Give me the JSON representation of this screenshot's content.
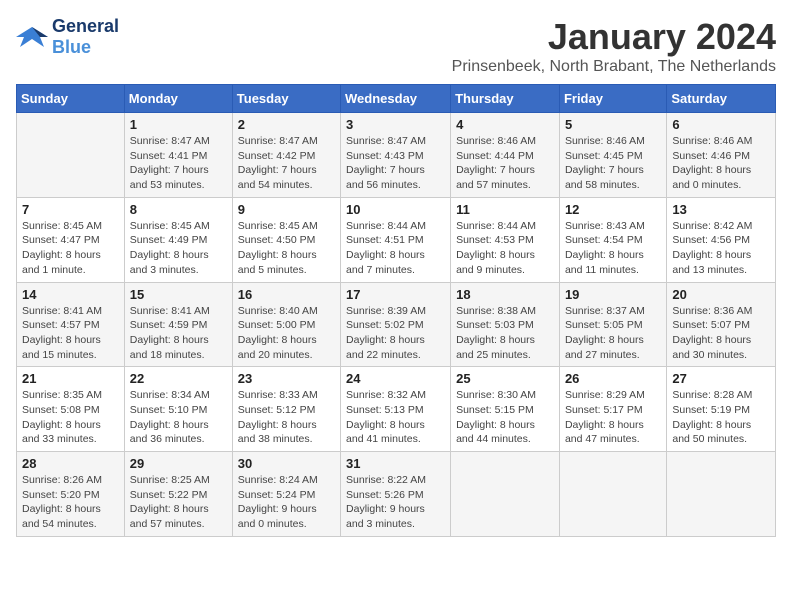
{
  "logo": {
    "line1": "General",
    "line2": "Blue"
  },
  "title": "January 2024",
  "subtitle": "Prinsenbeek, North Brabant, The Netherlands",
  "weekdays": [
    "Sunday",
    "Monday",
    "Tuesday",
    "Wednesday",
    "Thursday",
    "Friday",
    "Saturday"
  ],
  "weeks": [
    [
      {
        "day": "",
        "detail": ""
      },
      {
        "day": "1",
        "detail": "Sunrise: 8:47 AM\nSunset: 4:41 PM\nDaylight: 7 hours\nand 53 minutes."
      },
      {
        "day": "2",
        "detail": "Sunrise: 8:47 AM\nSunset: 4:42 PM\nDaylight: 7 hours\nand 54 minutes."
      },
      {
        "day": "3",
        "detail": "Sunrise: 8:47 AM\nSunset: 4:43 PM\nDaylight: 7 hours\nand 56 minutes."
      },
      {
        "day": "4",
        "detail": "Sunrise: 8:46 AM\nSunset: 4:44 PM\nDaylight: 7 hours\nand 57 minutes."
      },
      {
        "day": "5",
        "detail": "Sunrise: 8:46 AM\nSunset: 4:45 PM\nDaylight: 7 hours\nand 58 minutes."
      },
      {
        "day": "6",
        "detail": "Sunrise: 8:46 AM\nSunset: 4:46 PM\nDaylight: 8 hours\nand 0 minutes."
      }
    ],
    [
      {
        "day": "7",
        "detail": "Sunrise: 8:45 AM\nSunset: 4:47 PM\nDaylight: 8 hours\nand 1 minute."
      },
      {
        "day": "8",
        "detail": "Sunrise: 8:45 AM\nSunset: 4:49 PM\nDaylight: 8 hours\nand 3 minutes."
      },
      {
        "day": "9",
        "detail": "Sunrise: 8:45 AM\nSunset: 4:50 PM\nDaylight: 8 hours\nand 5 minutes."
      },
      {
        "day": "10",
        "detail": "Sunrise: 8:44 AM\nSunset: 4:51 PM\nDaylight: 8 hours\nand 7 minutes."
      },
      {
        "day": "11",
        "detail": "Sunrise: 8:44 AM\nSunset: 4:53 PM\nDaylight: 8 hours\nand 9 minutes."
      },
      {
        "day": "12",
        "detail": "Sunrise: 8:43 AM\nSunset: 4:54 PM\nDaylight: 8 hours\nand 11 minutes."
      },
      {
        "day": "13",
        "detail": "Sunrise: 8:42 AM\nSunset: 4:56 PM\nDaylight: 8 hours\nand 13 minutes."
      }
    ],
    [
      {
        "day": "14",
        "detail": "Sunrise: 8:41 AM\nSunset: 4:57 PM\nDaylight: 8 hours\nand 15 minutes."
      },
      {
        "day": "15",
        "detail": "Sunrise: 8:41 AM\nSunset: 4:59 PM\nDaylight: 8 hours\nand 18 minutes."
      },
      {
        "day": "16",
        "detail": "Sunrise: 8:40 AM\nSunset: 5:00 PM\nDaylight: 8 hours\nand 20 minutes."
      },
      {
        "day": "17",
        "detail": "Sunrise: 8:39 AM\nSunset: 5:02 PM\nDaylight: 8 hours\nand 22 minutes."
      },
      {
        "day": "18",
        "detail": "Sunrise: 8:38 AM\nSunset: 5:03 PM\nDaylight: 8 hours\nand 25 minutes."
      },
      {
        "day": "19",
        "detail": "Sunrise: 8:37 AM\nSunset: 5:05 PM\nDaylight: 8 hours\nand 27 minutes."
      },
      {
        "day": "20",
        "detail": "Sunrise: 8:36 AM\nSunset: 5:07 PM\nDaylight: 8 hours\nand 30 minutes."
      }
    ],
    [
      {
        "day": "21",
        "detail": "Sunrise: 8:35 AM\nSunset: 5:08 PM\nDaylight: 8 hours\nand 33 minutes."
      },
      {
        "day": "22",
        "detail": "Sunrise: 8:34 AM\nSunset: 5:10 PM\nDaylight: 8 hours\nand 36 minutes."
      },
      {
        "day": "23",
        "detail": "Sunrise: 8:33 AM\nSunset: 5:12 PM\nDaylight: 8 hours\nand 38 minutes."
      },
      {
        "day": "24",
        "detail": "Sunrise: 8:32 AM\nSunset: 5:13 PM\nDaylight: 8 hours\nand 41 minutes."
      },
      {
        "day": "25",
        "detail": "Sunrise: 8:30 AM\nSunset: 5:15 PM\nDaylight: 8 hours\nand 44 minutes."
      },
      {
        "day": "26",
        "detail": "Sunrise: 8:29 AM\nSunset: 5:17 PM\nDaylight: 8 hours\nand 47 minutes."
      },
      {
        "day": "27",
        "detail": "Sunrise: 8:28 AM\nSunset: 5:19 PM\nDaylight: 8 hours\nand 50 minutes."
      }
    ],
    [
      {
        "day": "28",
        "detail": "Sunrise: 8:26 AM\nSunset: 5:20 PM\nDaylight: 8 hours\nand 54 minutes."
      },
      {
        "day": "29",
        "detail": "Sunrise: 8:25 AM\nSunset: 5:22 PM\nDaylight: 8 hours\nand 57 minutes."
      },
      {
        "day": "30",
        "detail": "Sunrise: 8:24 AM\nSunset: 5:24 PM\nDaylight: 9 hours\nand 0 minutes."
      },
      {
        "day": "31",
        "detail": "Sunrise: 8:22 AM\nSunset: 5:26 PM\nDaylight: 9 hours\nand 3 minutes."
      },
      {
        "day": "",
        "detail": ""
      },
      {
        "day": "",
        "detail": ""
      },
      {
        "day": "",
        "detail": ""
      }
    ]
  ]
}
